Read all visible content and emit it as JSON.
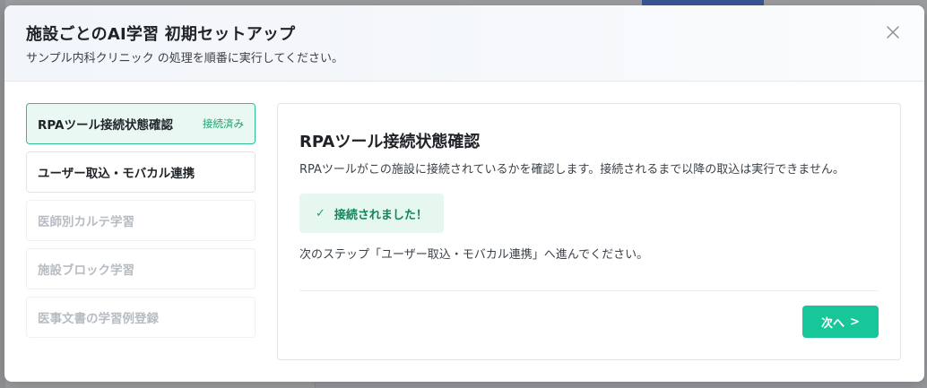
{
  "modal": {
    "title": "施設ごとのAI学習 初期セットアップ",
    "subtitle": "サンプル内科クリニック の処理を順番に実行してください。",
    "close_icon": "close-icon"
  },
  "steps": [
    {
      "label": "RPAツール接続状態確認",
      "badge": "接続済み",
      "state": "active"
    },
    {
      "label": "ユーザー取込・モバカル連携",
      "badge": "",
      "state": "enabled"
    },
    {
      "label": "医師別カルテ学習",
      "badge": "",
      "state": "disabled"
    },
    {
      "label": "施設ブロック学習",
      "badge": "",
      "state": "disabled"
    },
    {
      "label": "医事文書の学習例登録",
      "badge": "",
      "state": "disabled"
    }
  ],
  "content": {
    "title": "RPAツール接続状態確認",
    "description": "RPAツールがこの施設に接続されているかを確認します。接続されるまで以降の取込は実行できません。",
    "success_icon": "✓",
    "success_message": "接続されました！",
    "next_step_text": "次のステップ「ユーザー取込・モバカル連携」へ進んでください。",
    "next_button_label": "次へ",
    "next_button_icon": ">"
  },
  "colors": {
    "accent": "#17c79a",
    "active_bg": "#eaf8f3",
    "success_text": "#14855a"
  }
}
